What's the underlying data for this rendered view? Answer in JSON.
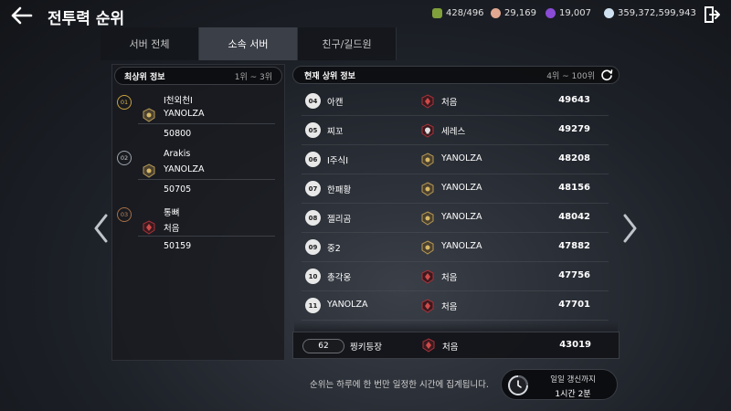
{
  "header": {
    "title": "전투력 순위",
    "currencies": [
      {
        "icon": "stamina-icon",
        "value": "428/496",
        "color": "#7fa03a"
      },
      {
        "icon": "gold-coin-icon",
        "value": "29,169",
        "color": "#e0a890"
      },
      {
        "icon": "purple-gem-icon",
        "value": "19,007",
        "color": "#8a4bd6"
      },
      {
        "icon": "silver-orb-icon",
        "value": "359,372,599,943",
        "color": "#cfe0f0"
      }
    ]
  },
  "tabs": [
    {
      "label": "서버 전체",
      "active": false
    },
    {
      "label": "소속 서버",
      "active": true
    },
    {
      "label": "친구/길드원",
      "active": false
    }
  ],
  "top_panel": {
    "title": "최상위 정보",
    "range": "1위 ~ 3위",
    "entries": [
      {
        "rank": "01",
        "name": "I천외천I",
        "guild": "YANOLZA",
        "score": "50800",
        "emblem": "gold"
      },
      {
        "rank": "02",
        "name": "Arakis",
        "guild": "YANOLZA",
        "score": "50705",
        "emblem": "gold"
      },
      {
        "rank": "03",
        "name": "통뼈",
        "guild": "처음",
        "score": "50159",
        "emblem": "red"
      }
    ]
  },
  "current_panel": {
    "title": "현재 상위 정보",
    "range": "4위 ~ 100위",
    "rows": [
      {
        "rank": "04",
        "name": "아캔",
        "guild": "처음",
        "score": "49643",
        "emblem": "red"
      },
      {
        "rank": "05",
        "name": "찌꼬",
        "guild": "세레스",
        "score": "49279",
        "emblem": "skull"
      },
      {
        "rank": "06",
        "name": "I주식I",
        "guild": "YANOLZA",
        "score": "48208",
        "emblem": "gold"
      },
      {
        "rank": "07",
        "name": "한패황",
        "guild": "YANOLZA",
        "score": "48156",
        "emblem": "gold"
      },
      {
        "rank": "08",
        "name": "젤리곰",
        "guild": "YANOLZA",
        "score": "48042",
        "emblem": "gold"
      },
      {
        "rank": "09",
        "name": "중2",
        "guild": "YANOLZA",
        "score": "47882",
        "emblem": "gold"
      },
      {
        "rank": "10",
        "name": "총각옹",
        "guild": "처음",
        "score": "47756",
        "emblem": "red"
      },
      {
        "rank": "11",
        "name": "YANOLZA",
        "guild": "처음",
        "score": "47701",
        "emblem": "red"
      }
    ]
  },
  "my_rank": {
    "rank": "62",
    "name": "찡키등장",
    "guild": "처음",
    "score": "43019",
    "emblem": "red"
  },
  "footer": {
    "notice": "순위는 하루에 한 번만 일정한 시간에 집계됩니다.",
    "timer_label": "일일 갱신까지",
    "timer_value": "1시간 2분"
  }
}
